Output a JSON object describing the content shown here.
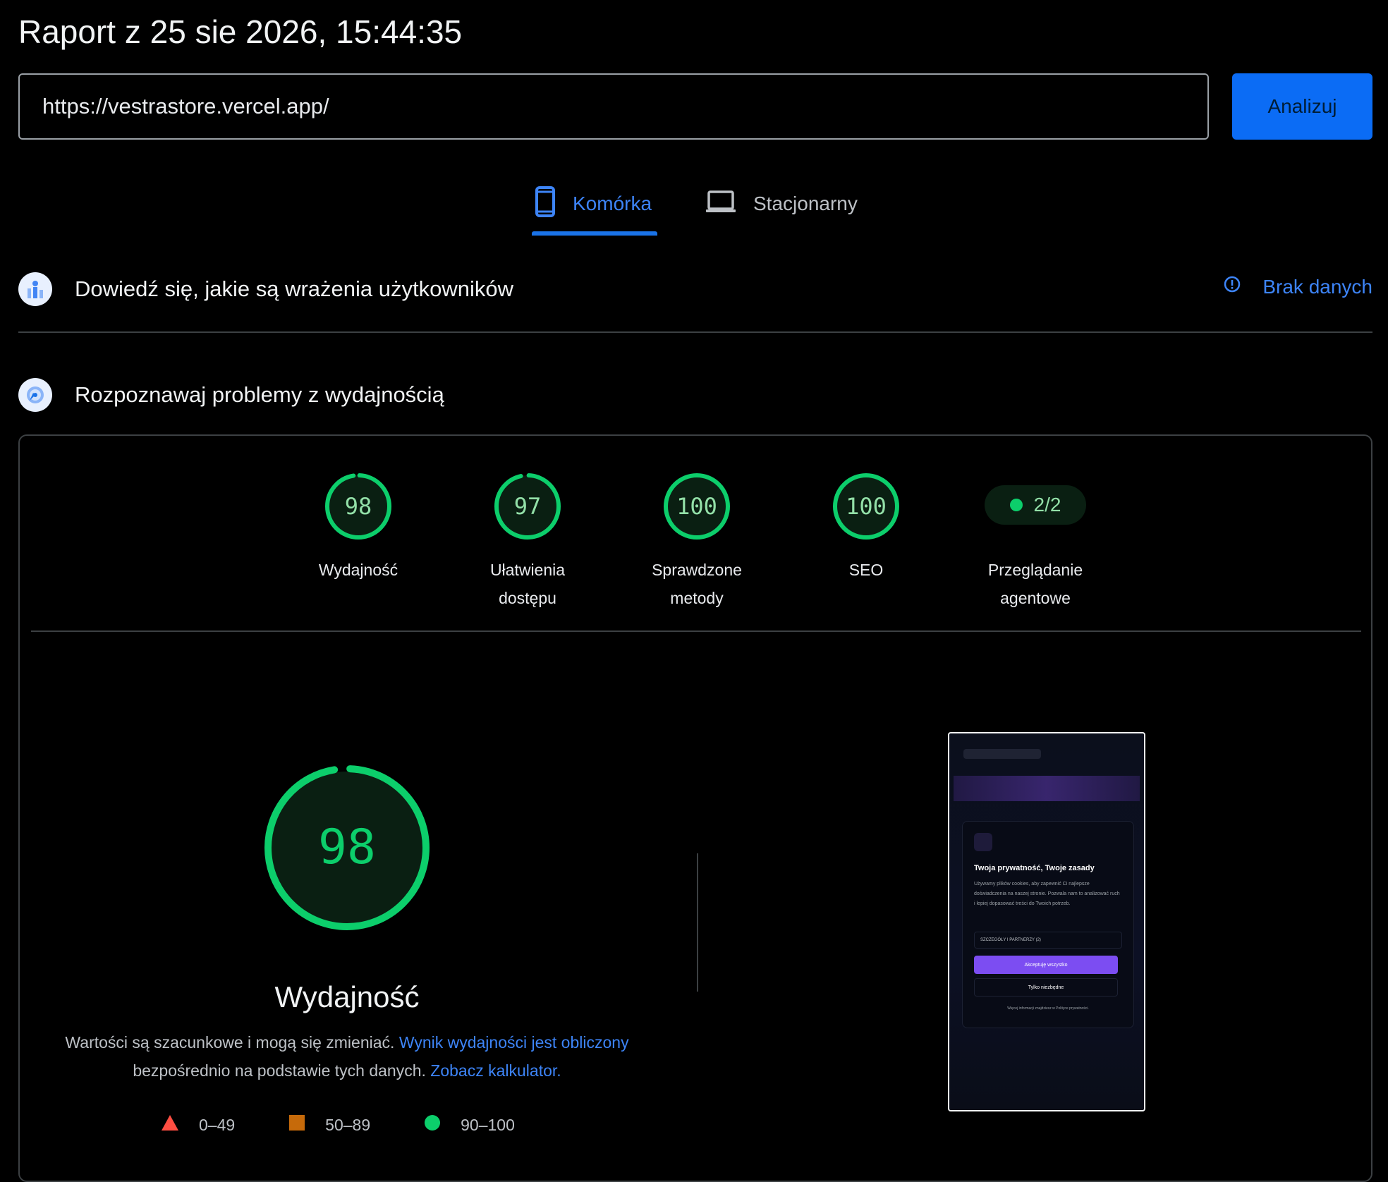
{
  "report": {
    "title": "Raport z 25 sie 2026, 15:44:35"
  },
  "search": {
    "url": "https://vestrastore.vercel.app/",
    "analyze_label": "Analizuj"
  },
  "tabs": [
    {
      "label": "Komórka",
      "active": true,
      "icon": "mobile-phone-icon"
    },
    {
      "label": "Stacjonarny",
      "active": false,
      "icon": "laptop-icon"
    }
  ],
  "field_section": {
    "title": "Dowiedź się, jakie są wrażenia użytkowników",
    "status": "Brak danych",
    "icon": "users-chart-icon"
  },
  "lab_section": {
    "title": "Rozpoznawaj problemy z wydajnością",
    "icon": "gauge-icon"
  },
  "scores": [
    {
      "value": "98",
      "label_line1": "Wydajność",
      "label_line2": "",
      "fraction": 0.98
    },
    {
      "value": "97",
      "label_line1": "Ułatwienia",
      "label_line2": "dostępu",
      "fraction": 0.97
    },
    {
      "value": "100",
      "label_line1": "Sprawdzone",
      "label_line2": "metody",
      "fraction": 1.0
    },
    {
      "value": "100",
      "label_line1": "SEO",
      "label_line2": "",
      "fraction": 1.0
    }
  ],
  "agentic": {
    "value": "2/2",
    "label_line1": "Przeglądanie",
    "label_line2": "agentowe"
  },
  "performance": {
    "score": "98",
    "fraction": 0.98,
    "title": "Wydajność",
    "desc_text1": "Wartości są szacunkowe i mogą się zmieniać. ",
    "desc_link1": "Wynik wydajności jest obliczony",
    "desc_text2": " bezpośrednio na podstawie tych danych. ",
    "desc_link2": "Zobacz kalkulator."
  },
  "legend": [
    {
      "range": "0–49",
      "shape": "triangle",
      "color": "#ff4e42"
    },
    {
      "range": "50–89",
      "shape": "square",
      "color": "#ffa400"
    },
    {
      "range": "90–100",
      "shape": "circle",
      "color": "#0cce6b"
    }
  ],
  "screenshot": {
    "card_title": "Twoja prywatność, Twoje zasady",
    "card_text": "Używamy plików cookies, aby zapewnić Ci najlepsze doświadczenia na naszej stronie. Pozwala nam to analizować ruch i lepiej dopasować treści do Twoich potrzeb.",
    "select_label": "SZCZEGÓŁY I PARTNERZY (2)",
    "accept_label": "Akceptuję wszystko",
    "necessary_label": "Tylko niezbędne",
    "footer_text": "Więcej informacji znajdziesz w Polityce prywatności."
  },
  "colors": {
    "accent": "#1a73e8",
    "pass": "#0cce6b",
    "pass_text": "#93e0a8"
  }
}
